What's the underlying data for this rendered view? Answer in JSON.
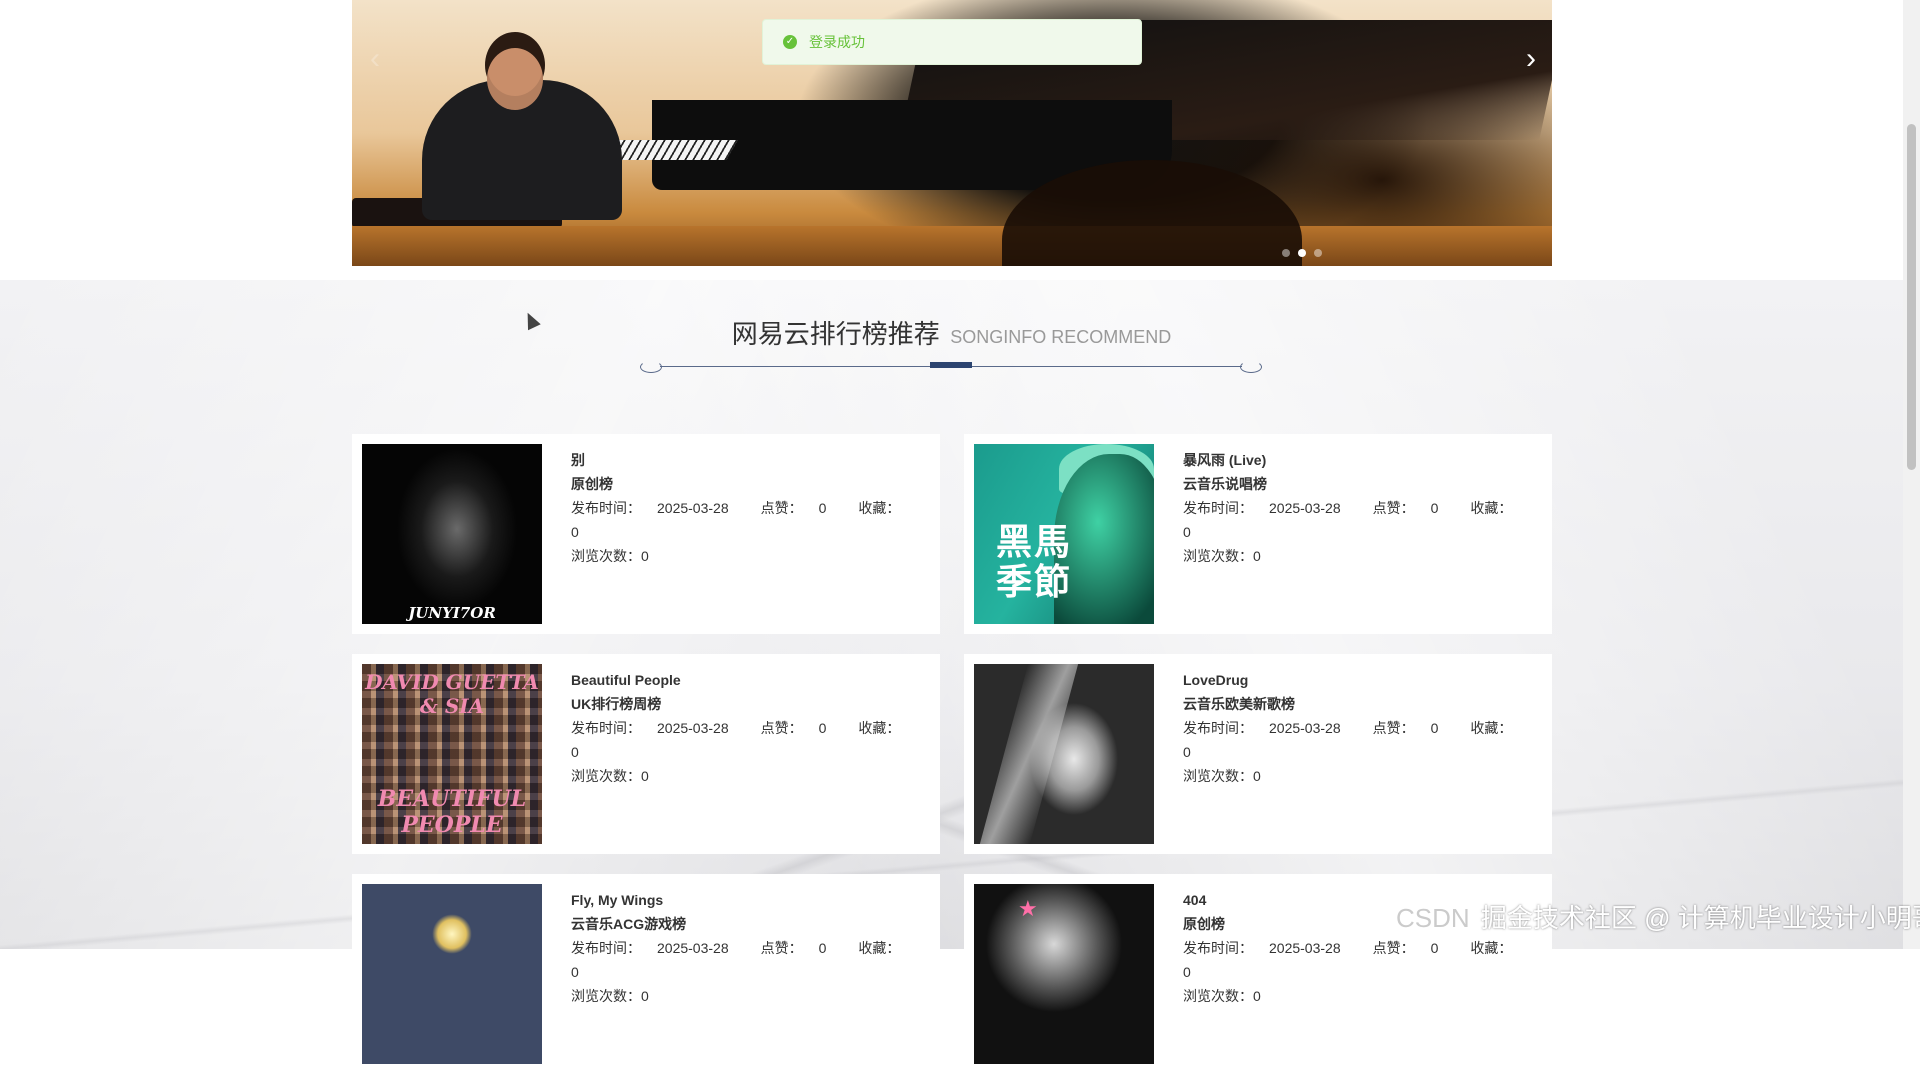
{
  "toast": {
    "text": "登录成功",
    "color": "#67c23a"
  },
  "banner": {
    "next_glyph": "›",
    "prev_glyph": "‹",
    "active_slide": 2,
    "slide_count": 3
  },
  "section": {
    "title_cn": "网易云排行榜推荐",
    "title_en": "SONGINFO RECOMMEND"
  },
  "labels": {
    "publish": "发布时间：",
    "likes": "点赞：",
    "favorites": "收藏：",
    "views": "浏览次数："
  },
  "songs": [
    {
      "name": "别",
      "chart": "原创榜",
      "date": "2025-03-28",
      "likes": "0",
      "favorites": "0",
      "views": "0",
      "cover_text": "JUNYI7OR"
    },
    {
      "name": "暴风雨 (Live)",
      "chart": "云音乐说唱榜",
      "date": "2025-03-28",
      "likes": "0",
      "favorites": "0",
      "views": "0",
      "cover_text": "黑馬\n季節"
    },
    {
      "name": "Beautiful People",
      "chart": "UK排行榜周榜",
      "date": "2025-03-28",
      "likes": "0",
      "favorites": "0",
      "views": "0",
      "cover_text_top": "DAVID GUETTA & SIA",
      "cover_text_bottom": "BEAUTIFUL PEOPLE"
    },
    {
      "name": "LoveDrug",
      "chart": "云音乐欧美新歌榜",
      "date": "2025-03-28",
      "likes": "0",
      "favorites": "0",
      "views": "0"
    },
    {
      "name": "Fly, My Wings",
      "chart": "云音乐ACG游戏榜",
      "date": "2025-03-28",
      "likes": "0",
      "favorites": "0",
      "views": "0"
    },
    {
      "name": "404",
      "chart": "原创榜",
      "date": "2025-03-28",
      "likes": "0",
      "favorites": "0",
      "views": "0"
    }
  ],
  "watermark": {
    "csdn": "CSDN",
    "text": "掘金技术社区 @ 计算机毕业设计小明哥"
  }
}
